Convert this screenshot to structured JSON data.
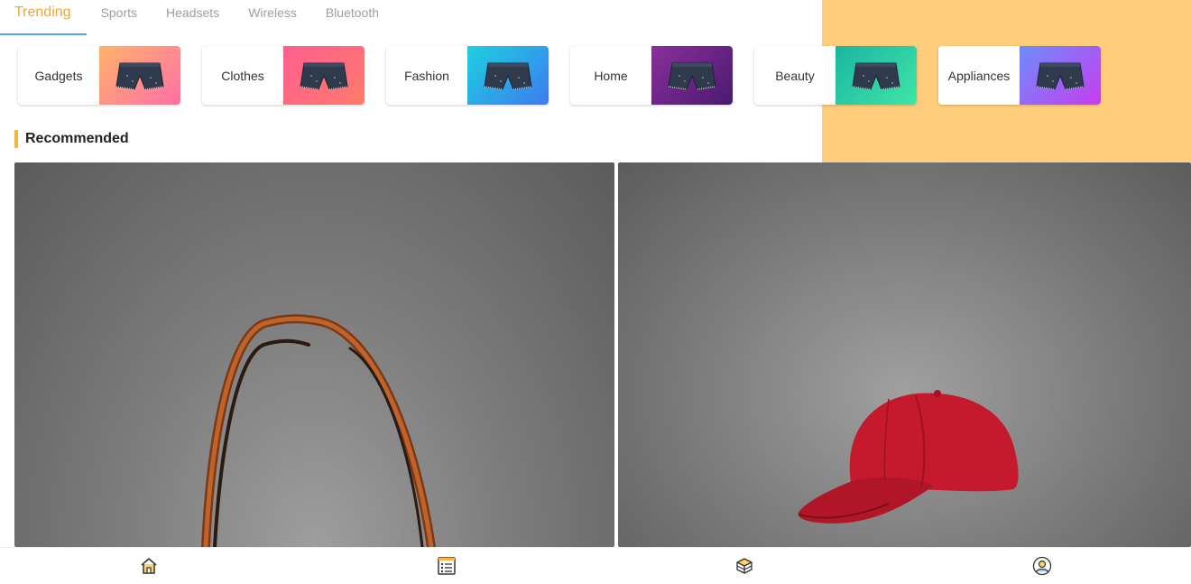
{
  "tabs": [
    "Trending",
    "Sports",
    "Headsets",
    "Wireless",
    "Bluetooth"
  ],
  "categories": [
    "Gadgets",
    "Clothes",
    "Fashion",
    "Home",
    "Beauty",
    "Appliances"
  ],
  "section": {
    "title": "Recommended"
  },
  "products": [
    {
      "icon": "handbag-image"
    },
    {
      "icon": "red-cap-image"
    }
  ],
  "bottom_nav": [
    "home-icon",
    "list-icon",
    "box-icon",
    "profile-icon"
  ],
  "colors": {
    "accent": "#f2a531",
    "tab_underline": "#5aa3d8",
    "top_banner": "#ffce7d",
    "section_bar": "#f7b538"
  }
}
